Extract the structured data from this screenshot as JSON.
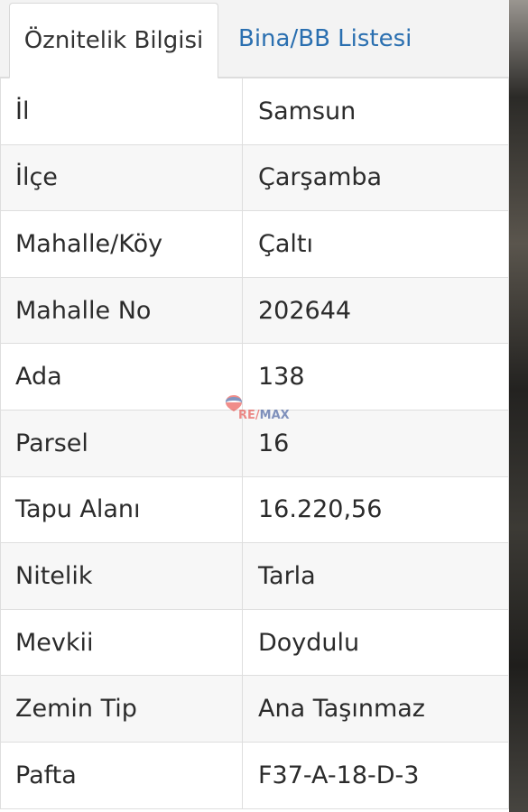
{
  "tabs": [
    {
      "label": "Öznitelik Bilgisi",
      "active": true
    },
    {
      "label": "Bina/BB Listesi",
      "active": false
    }
  ],
  "rows": [
    {
      "key": "İl",
      "value": "Samsun"
    },
    {
      "key": "İlçe",
      "value": "Çarşamba"
    },
    {
      "key": "Mahalle/Köy",
      "value": "Çaltı"
    },
    {
      "key": "Mahalle No",
      "value": "202644"
    },
    {
      "key": "Ada",
      "value": "138"
    },
    {
      "key": "Parsel",
      "value": "16"
    },
    {
      "key": "Tapu Alanı",
      "value": "16.220,56"
    },
    {
      "key": "Nitelik",
      "value": "Tarla"
    },
    {
      "key": "Mevkii",
      "value": "Doydulu"
    },
    {
      "key": "Zemin Tip",
      "value": "Ana Taşınmaz"
    },
    {
      "key": "Pafta",
      "value": "F37-A-18-D-3"
    }
  ],
  "watermark": {
    "text": "RE/MAX",
    "colors": {
      "red": "#e4312b",
      "blue": "#1f3f8c"
    }
  },
  "colors": {
    "tab_link": "#2a6fb0",
    "border": "#dedede"
  }
}
